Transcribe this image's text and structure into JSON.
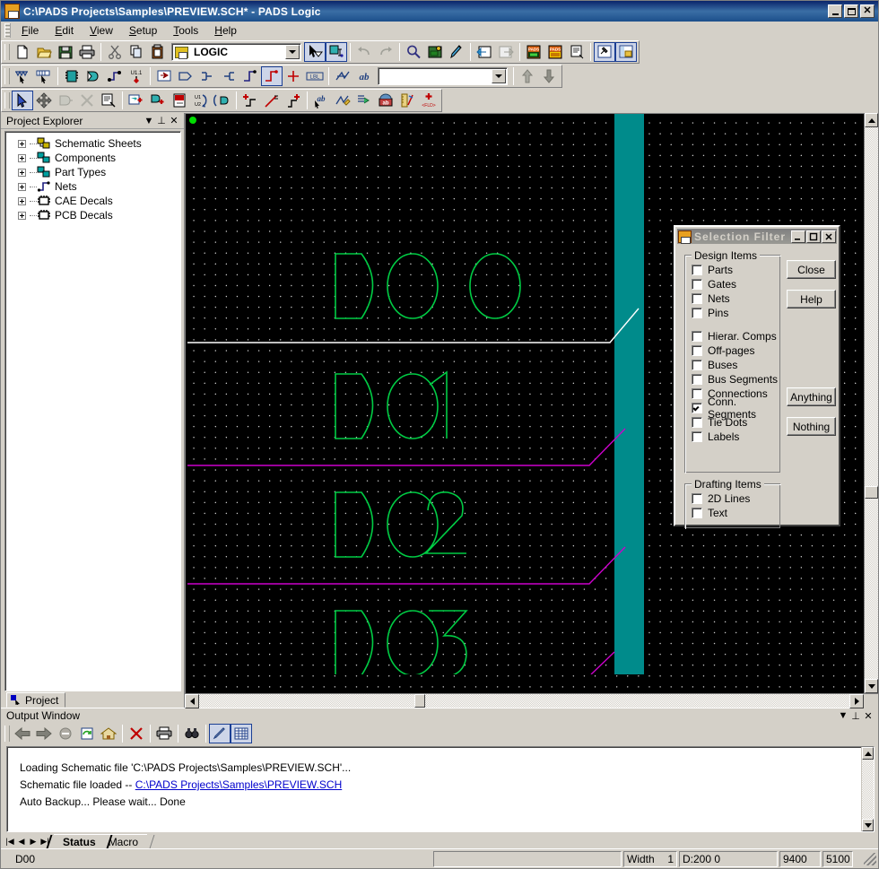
{
  "window": {
    "title": "C:\\PADS Projects\\Samples\\PREVIEW.SCH* - PADS Logic",
    "icon": "pads-app-icon",
    "minimize": "_",
    "maximize": "□",
    "close": "✕"
  },
  "menu": {
    "items": [
      {
        "label": "File",
        "accel": "F"
      },
      {
        "label": "Edit",
        "accel": "E"
      },
      {
        "label": "View",
        "accel": "V"
      },
      {
        "label": "Setup",
        "accel": "S"
      },
      {
        "label": "Tools",
        "accel": "T"
      },
      {
        "label": "Help",
        "accel": "H"
      }
    ]
  },
  "toolbars": {
    "standard": {
      "sheet_combo_value": "LOGIC",
      "sheet_combo_placeholder": "",
      "buttons": [
        {
          "name": "new-file-button",
          "icon": "new-document-icon"
        },
        {
          "name": "open-file-button",
          "icon": "open-folder-icon"
        },
        {
          "name": "save-file-button",
          "icon": "floppy-disk-icon"
        },
        {
          "name": "print-button",
          "icon": "printer-icon"
        },
        {
          "name": "cut-button",
          "icon": "scissors-icon"
        },
        {
          "name": "copy-button",
          "icon": "copy-pages-icon"
        },
        {
          "name": "paste-button",
          "icon": "clipboard-icon"
        },
        {
          "name": "select-mode-button",
          "icon": "arrow-filter-icon",
          "pressed": true
        },
        {
          "name": "net-select-button",
          "icon": "net-highlight-icon",
          "pressed": true
        },
        {
          "name": "undo-button",
          "icon": "undo-arrow-icon",
          "disabled": true
        },
        {
          "name": "redo-button",
          "icon": "redo-arrow-icon",
          "disabled": true
        },
        {
          "name": "zoom-button",
          "icon": "magnifier-icon"
        },
        {
          "name": "board-view-button",
          "icon": "board-window-icon"
        },
        {
          "name": "redraw-button",
          "icon": "paint-brush-icon"
        },
        {
          "name": "eco-in-button",
          "icon": "eco-import-icon"
        },
        {
          "name": "eco-out-button",
          "icon": "eco-export-icon",
          "disabled": true
        },
        {
          "name": "pads-layout-button",
          "icon": "pads-layout-icon"
        },
        {
          "name": "pads-router-button",
          "icon": "pads-router-icon"
        },
        {
          "name": "report-button",
          "icon": "report-page-icon"
        },
        {
          "name": "design-tools-button",
          "icon": "hammer-icon",
          "pressed": true
        },
        {
          "name": "library-button",
          "icon": "library-icon",
          "pressed": true
        }
      ]
    },
    "design": {
      "search_combo_value": "",
      "search_combo_placeholder": "",
      "buttons": [
        {
          "name": "select-net-button",
          "icon": "net-pointer-icon"
        },
        {
          "name": "select-bus-button",
          "icon": "bus-pointer-icon"
        },
        {
          "name": "add-part-button",
          "icon": "chip-icon"
        },
        {
          "name": "add-connection-button",
          "icon": "connection-icon"
        },
        {
          "name": "add-net-button",
          "icon": "net-node-icon"
        },
        {
          "name": "add-pin-button",
          "icon": "pin-u11-icon"
        },
        {
          "name": "hierarchical-comp-button",
          "icon": "hier-comp-icon"
        },
        {
          "name": "off-page-button",
          "icon": "off-page-icon"
        },
        {
          "name": "bus-in-button",
          "icon": "bus-in-icon"
        },
        {
          "name": "bus-out-button",
          "icon": "bus-out-icon"
        },
        {
          "name": "add-conn-segment-button",
          "icon": "conn-segment-icon"
        },
        {
          "name": "add-conn-segment2-button",
          "icon": "conn-segment-red-icon",
          "pressed": true
        },
        {
          "name": "tie-dot-button",
          "icon": "tie-dot-icon"
        },
        {
          "name": "label-button",
          "icon": "lbl-icon"
        },
        {
          "name": "2d-line-button",
          "icon": "polyline-icon"
        },
        {
          "name": "text-button",
          "icon": "ab-text-icon"
        },
        {
          "name": "prev-item-button",
          "icon": "up-arrow-icon"
        },
        {
          "name": "next-item-button",
          "icon": "down-arrow-icon"
        }
      ]
    },
    "edit": {
      "buttons": [
        {
          "name": "select-tool-button",
          "icon": "arrow-cursor-icon",
          "pressed": true
        },
        {
          "name": "move-tool-button",
          "icon": "move-cross-icon"
        },
        {
          "name": "rotate-tool-button",
          "icon": "rotate-gate-icon",
          "disabled": true
        },
        {
          "name": "delete-tool-button",
          "icon": "x-delete-icon",
          "disabled": true
        },
        {
          "name": "properties-button",
          "icon": "properties-icon"
        },
        {
          "name": "add-part-edit-button",
          "icon": "add-part-icon"
        },
        {
          "name": "add-conn-edit-button",
          "icon": "add-connection-icon"
        },
        {
          "name": "add-sheet-button",
          "icon": "add-sheet-icon"
        },
        {
          "name": "swap-pins-button",
          "icon": "swap-u1u2-icon"
        },
        {
          "name": "swap-gates-button",
          "icon": "swap-gate-icon"
        },
        {
          "name": "add-segment-button",
          "icon": "add-segment-icon"
        },
        {
          "name": "split-segment-button",
          "icon": "split-segment-icon"
        },
        {
          "name": "join-segment-button",
          "icon": "join-segment-icon"
        },
        {
          "name": "net-rename-button",
          "icon": "net-rename-icon"
        },
        {
          "name": "edit-line-button",
          "icon": "edit-line-icon"
        },
        {
          "name": "edit-bus-button",
          "icon": "edit-bus-icon"
        },
        {
          "name": "edit-attrs-button",
          "icon": "edit-attributes-icon"
        },
        {
          "name": "measure-button",
          "icon": "ruler-icon"
        },
        {
          "name": "add-field-button",
          "icon": "add-field-icon"
        }
      ]
    }
  },
  "explorer": {
    "caption": "Project Explorer",
    "caption_buttons": [
      {
        "name": "panel-menu-button",
        "glyph": "▼"
      },
      {
        "name": "panel-pin-button",
        "glyph": "⊥"
      },
      {
        "name": "panel-close-button",
        "glyph": "✕"
      }
    ],
    "tree": [
      {
        "label": "Schematic Sheets",
        "icon": "schematic-sheets-icon",
        "color": "#c8b400"
      },
      {
        "label": "Components",
        "icon": "components-icon",
        "color": "#008080"
      },
      {
        "label": "Part Types",
        "icon": "part-types-icon",
        "color": "#008080"
      },
      {
        "label": "Nets",
        "icon": "nets-icon",
        "color": "#2020a0"
      },
      {
        "label": "CAE Decals",
        "icon": "cae-decals-icon",
        "color": "#000000"
      },
      {
        "label": "PCB Decals",
        "icon": "pcb-decals-icon",
        "color": "#000000"
      }
    ],
    "tab": "Project"
  },
  "canvas": {
    "background": "#000000",
    "grid_dot_color": "#ffffff",
    "origin_marker_color": "#00cc00",
    "labels": [
      "D00",
      "D01",
      "D02",
      "D03"
    ],
    "bus_bar_color": "#008b8b",
    "white_net_color": "#ffffff",
    "magenta_net_color": "#cc00cc",
    "text_outline_color": "#00cc44"
  },
  "dialog": {
    "title": "Selection Filter",
    "icon": "pads-app-icon",
    "window_buttons": [
      {
        "name": "dialog-minimize-button",
        "glyph": "_"
      },
      {
        "name": "dialog-maximize-button",
        "glyph": "□"
      },
      {
        "name": "dialog-close-button",
        "glyph": "✕"
      }
    ],
    "design_items_group": "Design Items",
    "design_items": [
      {
        "label": "Parts",
        "checked": false
      },
      {
        "label": "Gates",
        "checked": false
      },
      {
        "label": "Nets",
        "checked": false
      },
      {
        "label": "Pins",
        "checked": false
      },
      {
        "label": "Hierar. Comps",
        "checked": false
      },
      {
        "label": "Off-pages",
        "checked": false
      },
      {
        "label": "Buses",
        "checked": false
      },
      {
        "label": "Bus Segments",
        "checked": false
      },
      {
        "label": "Connections",
        "checked": false
      },
      {
        "label": "Conn. Segments",
        "checked": true
      },
      {
        "label": "Tie Dots",
        "checked": false
      },
      {
        "label": "Labels",
        "checked": false
      }
    ],
    "drafting_items_group": "Drafting Items",
    "drafting_items": [
      {
        "label": "2D Lines",
        "checked": false
      },
      {
        "label": "Text",
        "checked": false
      }
    ],
    "buttons": [
      {
        "label": "Close",
        "name": "dialog-close-action-button"
      },
      {
        "label": "Help",
        "name": "dialog-help-button"
      },
      {
        "label": "Anything",
        "name": "dialog-anything-button"
      },
      {
        "label": "Nothing",
        "name": "dialog-nothing-button"
      }
    ]
  },
  "output": {
    "caption": "Output Window",
    "caption_buttons": [
      {
        "name": "output-menu-button",
        "glyph": "▼"
      },
      {
        "name": "output-pin-button",
        "glyph": "⊥"
      },
      {
        "name": "output-close-button",
        "glyph": "✕"
      }
    ],
    "toolbar": [
      {
        "name": "back-button",
        "icon": "left-arrow-icon"
      },
      {
        "name": "forward-button",
        "icon": "right-arrow-icon"
      },
      {
        "name": "stop-button",
        "icon": "stop-circle-icon"
      },
      {
        "name": "refresh-button",
        "icon": "refresh-icon"
      },
      {
        "name": "home-button",
        "icon": "home-icon"
      },
      {
        "name": "clear-button",
        "icon": "red-x-icon"
      },
      {
        "name": "print-output-button",
        "icon": "printer-icon"
      },
      {
        "name": "find-button",
        "icon": "binoculars-icon"
      },
      {
        "name": "edit-output-button",
        "icon": "pen-icon",
        "pressed": true
      },
      {
        "name": "grid-output-button",
        "icon": "grid-table-icon",
        "pressed": true
      }
    ],
    "lines": [
      {
        "text": "Loading Schematic file 'C:\\PADS Projects\\Samples\\PREVIEW.SCH'...",
        "link": false
      },
      {
        "prefix": "Schematic file loaded -- ",
        "text": "C:\\PADS Projects\\Samples\\PREVIEW.SCH",
        "link": true
      },
      {
        "text": "Auto Backup... Please wait... Done",
        "link": false
      }
    ],
    "tabs": [
      {
        "label": "Status",
        "active": true
      },
      {
        "label": "Macro",
        "active": false
      }
    ],
    "tab_nav": [
      "|◀",
      "◀",
      "▶",
      "▶|"
    ]
  },
  "statusbar": {
    "left_text": "D00",
    "message": "",
    "width_label": "Width",
    "width_value": "1",
    "design_value": "D:200 0",
    "x_coord": "9400",
    "y_coord": "5100"
  }
}
